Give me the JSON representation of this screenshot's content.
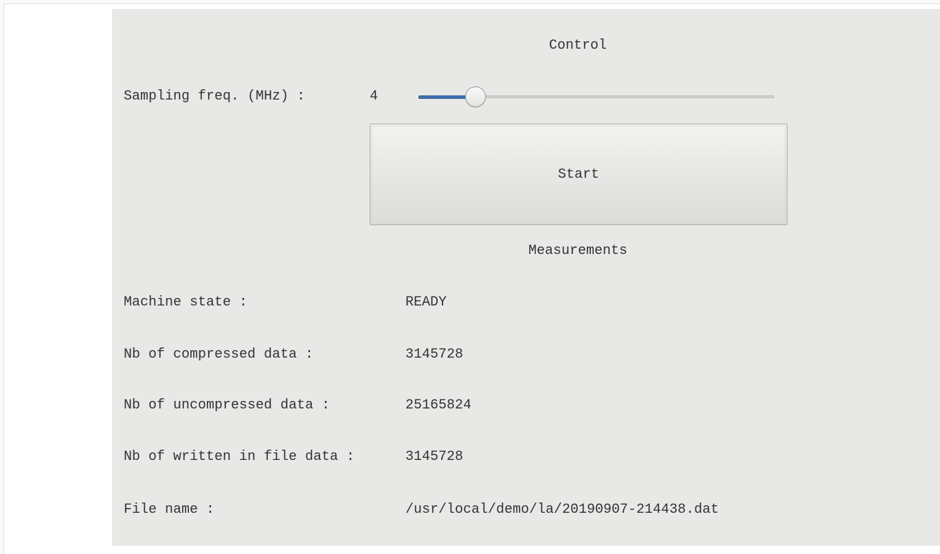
{
  "control": {
    "heading": "Control",
    "sampling_label": "Sampling freq. (MHz) :",
    "sampling_value": "4",
    "slider_fraction": 0.16,
    "start_label": "Start"
  },
  "measurements": {
    "heading": "Measurements",
    "rows": [
      {
        "label": "Machine state :",
        "value": "READY"
      },
      {
        "label": "Nb of compressed data :",
        "value": "3145728"
      },
      {
        "label": "Nb of uncompressed data :",
        "value": "25165824"
      },
      {
        "label": "Nb of written in file data :",
        "value": "3145728"
      },
      {
        "label": "File name :",
        "value": "/usr/local/demo/la/20190907-214438.dat"
      }
    ]
  },
  "colors": {
    "panel_bg": "#e8e8e6",
    "slider_accent": "#3f6fae"
  }
}
